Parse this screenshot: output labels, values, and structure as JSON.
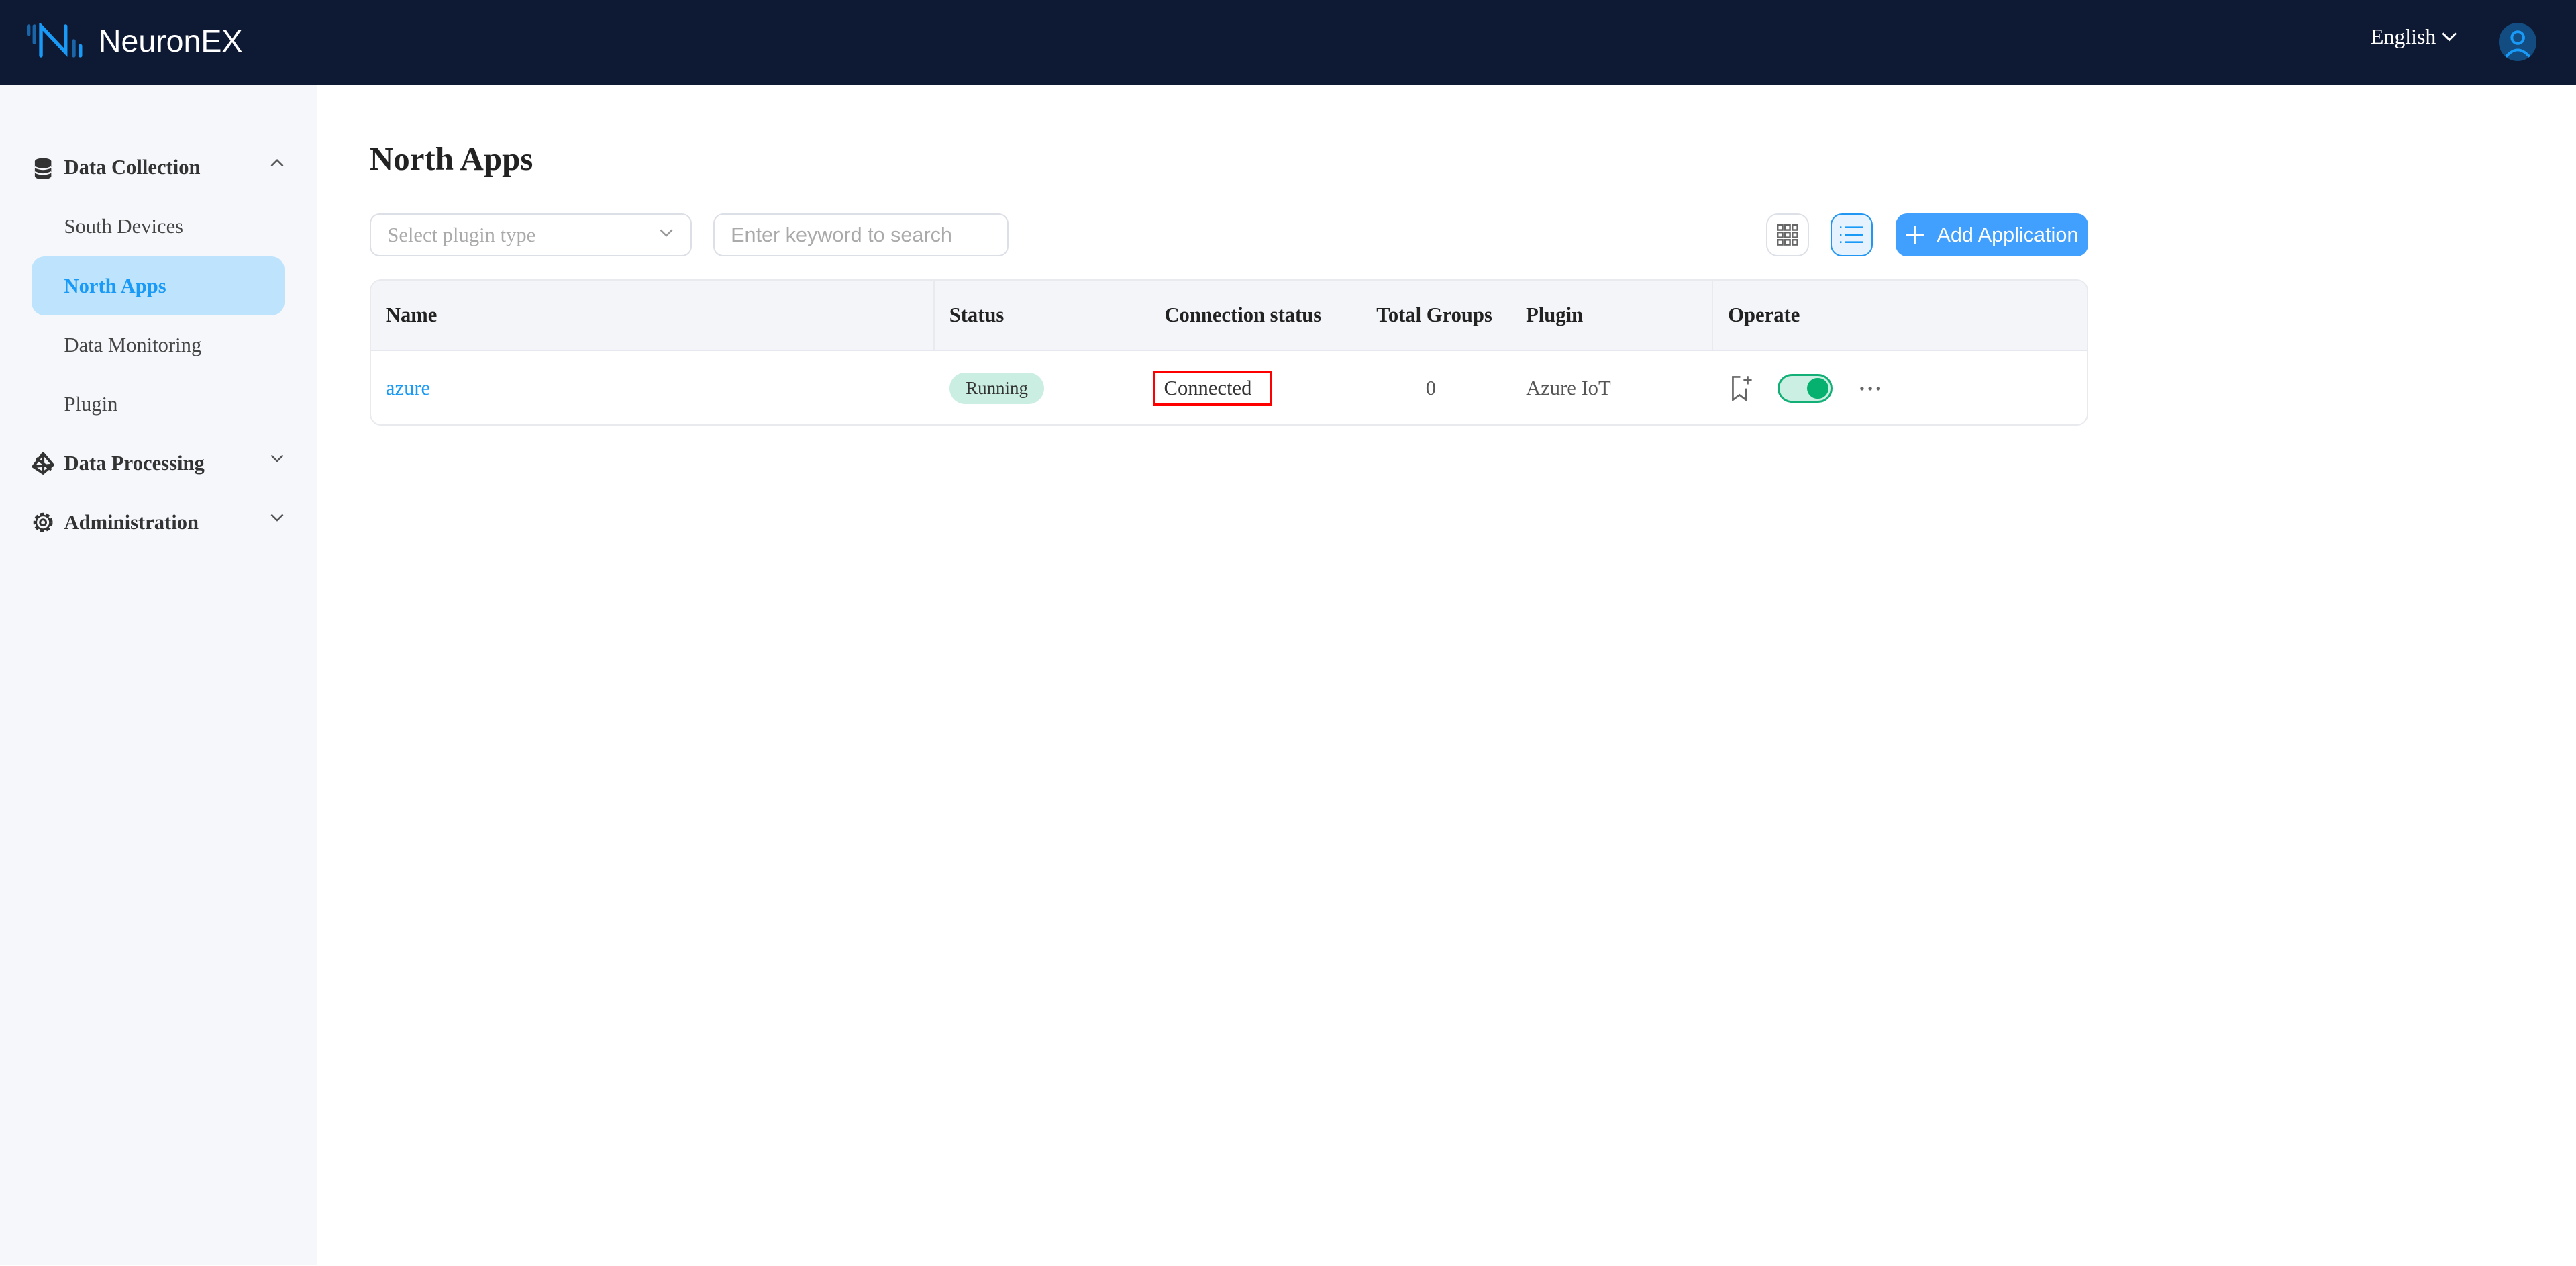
{
  "header": {
    "brand": "NeuronEX",
    "language": "English"
  },
  "sidebar": {
    "groups": [
      {
        "label": "Data Collection",
        "expanded": true,
        "items": [
          {
            "label": "South Devices"
          },
          {
            "label": "North Apps",
            "active": true
          },
          {
            "label": "Data Monitoring"
          },
          {
            "label": "Plugin"
          }
        ]
      },
      {
        "label": "Data Processing",
        "expanded": false
      },
      {
        "label": "Administration",
        "expanded": false
      }
    ]
  },
  "main": {
    "title": "North Apps",
    "plugin_select_placeholder": "Select plugin type",
    "search_placeholder": "Enter keyword to search",
    "add_label": "Add Application",
    "columns": [
      "Name",
      "Status",
      "Connection status",
      "Total Groups",
      "Plugin",
      "Operate"
    ],
    "rows": [
      {
        "name": "azure",
        "status": "Running",
        "connection": "Connected",
        "groups": "0",
        "plugin": "Azure IoT",
        "enabled": true
      }
    ]
  },
  "colors": {
    "header_bg": "#0e1a33",
    "accent": "#1a9af7",
    "running": "#cbeee2",
    "toggle_on": "#06b06e"
  }
}
